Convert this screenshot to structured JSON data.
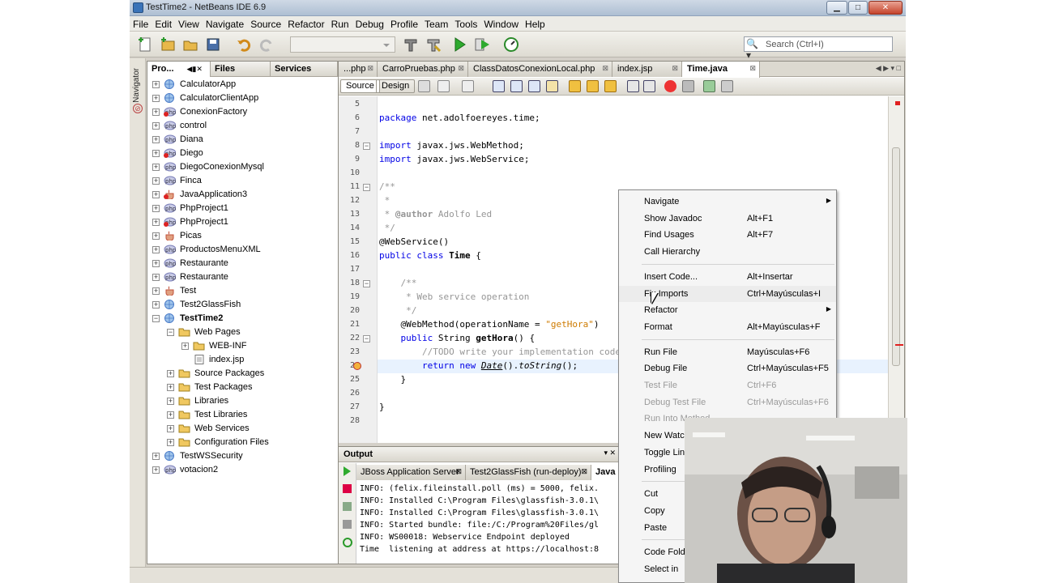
{
  "window": {
    "title": "TestTime2 - NetBeans IDE 6.9"
  },
  "menubar": [
    "File",
    "Edit",
    "View",
    "Navigate",
    "Source",
    "Refactor",
    "Run",
    "Debug",
    "Profile",
    "Team",
    "Tools",
    "Window",
    "Help"
  ],
  "toolbar": {
    "search_placeholder": "Search (Ctrl+I)"
  },
  "navigator_label": "Navigator",
  "project_panel": {
    "tabs": [
      "Pro...",
      "Files",
      "Services"
    ],
    "items": [
      {
        "label": "CalculatorApp",
        "type": "web",
        "depth": 0
      },
      {
        "label": "CalculatorClientApp",
        "type": "web",
        "depth": 0
      },
      {
        "label": "ConexionFactory",
        "type": "php-err",
        "depth": 0
      },
      {
        "label": "control",
        "type": "php",
        "depth": 0
      },
      {
        "label": "Diana",
        "type": "php",
        "depth": 0
      },
      {
        "label": "Diego",
        "type": "php-err",
        "depth": 0
      },
      {
        "label": "DiegoConexionMysql",
        "type": "php",
        "depth": 0
      },
      {
        "label": "Finca",
        "type": "php",
        "depth": 0
      },
      {
        "label": "JavaApplication3",
        "type": "java-err",
        "depth": 0
      },
      {
        "label": "PhpProject1",
        "type": "php",
        "depth": 0
      },
      {
        "label": "PhpProject1",
        "type": "php-err",
        "depth": 0
      },
      {
        "label": "Picas",
        "type": "java",
        "depth": 0
      },
      {
        "label": "ProductosMenuXML",
        "type": "php",
        "depth": 0
      },
      {
        "label": "Restaurante",
        "type": "php",
        "depth": 0
      },
      {
        "label": "Restaurante",
        "type": "php",
        "depth": 0
      },
      {
        "label": "Test",
        "type": "java",
        "depth": 0
      },
      {
        "label": "Test2GlassFish",
        "type": "web",
        "depth": 0
      },
      {
        "label": "TestTime2",
        "type": "web",
        "depth": 0,
        "expanded": true,
        "selected": true
      },
      {
        "label": "Web Pages",
        "type": "folder",
        "depth": 1,
        "expanded": true
      },
      {
        "label": "WEB-INF",
        "type": "folder",
        "depth": 2
      },
      {
        "label": "index.jsp",
        "type": "file",
        "depth": 2,
        "leaf": true
      },
      {
        "label": "Source Packages",
        "type": "folder",
        "depth": 1
      },
      {
        "label": "Test Packages",
        "type": "folder",
        "depth": 1
      },
      {
        "label": "Libraries",
        "type": "folder",
        "depth": 1
      },
      {
        "label": "Test Libraries",
        "type": "folder",
        "depth": 1
      },
      {
        "label": "Web Services",
        "type": "folder",
        "depth": 1
      },
      {
        "label": "Configuration Files",
        "type": "folder",
        "depth": 1
      },
      {
        "label": "TestWSSecurity",
        "type": "web",
        "depth": 0
      },
      {
        "label": "votacion2",
        "type": "php",
        "depth": 0
      }
    ]
  },
  "editor": {
    "tabs": [
      "...php",
      "CarroPruebas.php",
      "ClassDatosConexionLocal.php",
      "index.jsp",
      "Time.java"
    ],
    "active_tab": "Time.java",
    "modes": [
      "Source",
      "Design"
    ],
    "lines": [
      {
        "n": "5",
        "html": ""
      },
      {
        "n": "6",
        "html": "<span class=\"kw\">package</span> net.adolfoereyes.time;"
      },
      {
        "n": "7",
        "html": ""
      },
      {
        "n": "8",
        "html": "<span class=\"kw\">import</span> javax.jws.WebMethod;",
        "fold": true
      },
      {
        "n": "9",
        "html": "<span class=\"kw\">import</span> javax.jws.WebService;"
      },
      {
        "n": "10",
        "html": ""
      },
      {
        "n": "11",
        "html": "<span class=\"cm\">/**</span>",
        "fold": true
      },
      {
        "n": "12",
        "html": "<span class=\"cm\"> *</span>"
      },
      {
        "n": "13",
        "html": "<span class=\"cm\"> * </span><span class=\"cm bd\">@author</span><span class=\"cm\"> Adolfo Led</span>"
      },
      {
        "n": "14",
        "html": "<span class=\"cm\"> */</span>"
      },
      {
        "n": "15",
        "html": "@WebService()"
      },
      {
        "n": "16",
        "html": "<span class=\"kw\">public class</span> <span class=\"bd\">Time</span> {"
      },
      {
        "n": "17",
        "html": ""
      },
      {
        "n": "18",
        "html": "    <span class=\"cm\">/**</span>",
        "fold": true
      },
      {
        "n": "19",
        "html": "<span class=\"cm\">     * Web service operation</span>"
      },
      {
        "n": "20",
        "html": "<span class=\"cm\">     */</span>"
      },
      {
        "n": "21",
        "html": "    @WebMethod(operationName = <span class=\"st\">\"getHora\"</span>)"
      },
      {
        "n": "22",
        "html": "    <span class=\"kw\">public</span> String <span class=\"bd\">getHora</span>() {",
        "fold": true
      },
      {
        "n": "23",
        "html": "        <span class=\"cm\">//TODO write your implementation code here:</span>"
      },
      {
        "n": "24",
        "html": "        <span class=\"kw\">return new</span> <span class=\"it\" style=\"text-decoration:underline\">Date</span>().<span class=\"it\">toString</span>();",
        "hl": true,
        "marker": true
      },
      {
        "n": "25",
        "html": "    }"
      },
      {
        "n": "26",
        "html": ""
      },
      {
        "n": "27",
        "html": "}"
      },
      {
        "n": "28",
        "html": ""
      }
    ]
  },
  "output": {
    "title": "Output",
    "tabs": [
      "JBoss Application Server",
      "Test2GlassFish (run-deploy)",
      "Java"
    ],
    "lines": [
      "INFO: (felix.fileinstall.poll (ms) = 5000, felix.",
      "INFO: Installed C:\\Program Files\\glassfish-3.0.1\\",
      "INFO: Installed C:\\Program Files\\glassfish-3.0.1\\",
      "INFO: Started bundle: file:/C:/Program%20Files/gl",
      "INFO: WS00018: Webservice Endpoint deployed",
      "Time  listening at address at https://localhost:8"
    ]
  },
  "context_menu": {
    "items": [
      {
        "label": "Navigate",
        "shortcut": "",
        "submenu": true
      },
      {
        "label": "Show Javadoc",
        "shortcut": "Alt+F1"
      },
      {
        "label": "Find Usages",
        "shortcut": "Alt+F7"
      },
      {
        "label": "Call Hierarchy",
        "shortcut": ""
      },
      {
        "sep": true
      },
      {
        "label": "Insert Code...",
        "shortcut": "Alt+Insertar"
      },
      {
        "label": "Fix Imports",
        "shortcut": "Ctrl+Mayúsculas+I",
        "highlight": true
      },
      {
        "label": "Refactor",
        "shortcut": "",
        "submenu": true
      },
      {
        "label": "Format",
        "shortcut": "Alt+Mayúsculas+F"
      },
      {
        "sep": true
      },
      {
        "label": "Run File",
        "shortcut": "Mayúsculas+F6"
      },
      {
        "label": "Debug File",
        "shortcut": "Ctrl+Mayúsculas+F5"
      },
      {
        "label": "Test File",
        "shortcut": "Ctrl+F6",
        "disabled": true
      },
      {
        "label": "Debug Test File",
        "shortcut": "Ctrl+Mayúsculas+F6",
        "disabled": true
      },
      {
        "label": "Run Into Method",
        "shortcut": "",
        "disabled": true
      },
      {
        "label": "New Watch...",
        "shortcut": ""
      },
      {
        "label": "Toggle Line Breakpoint",
        "shortcut": ""
      },
      {
        "label": "Profiling",
        "shortcut": "",
        "submenu": true
      },
      {
        "sep": true
      },
      {
        "label": "Cut",
        "shortcut": ""
      },
      {
        "label": "Copy",
        "shortcut": ""
      },
      {
        "label": "Paste",
        "shortcut": ""
      },
      {
        "sep": true
      },
      {
        "label": "Code Folds",
        "shortcut": ""
      },
      {
        "label": "Select in",
        "shortcut": ""
      }
    ],
    "visible_labels": [
      "Navigate",
      "Show Javadoc",
      "Find Usages",
      "Call Hierarchy",
      "Insert Code...",
      "Fix Imports",
      "Refactor",
      "Format",
      "Run File",
      "Debug File",
      "Test File",
      "Debug Test File",
      "Run Into Method",
      "New Watc",
      "Toggle Lin",
      "Profiling",
      "Cut",
      "Copy",
      "Paste",
      "Code Fold",
      "Select in"
    ]
  },
  "colors": {
    "keyword": "#0000e6",
    "comment": "#969696",
    "string": "#ce7b00",
    "highlight_line": "#e8f2fe"
  }
}
